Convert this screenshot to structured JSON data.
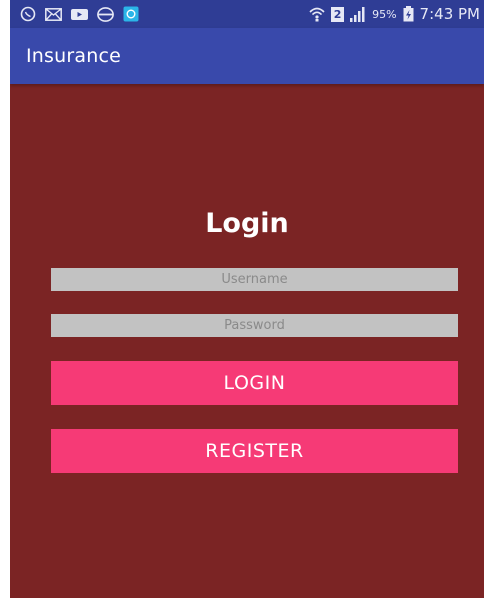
{
  "status_bar": {
    "left_icons": [
      "whatsapp-icon",
      "mail-icon",
      "video-icon",
      "browser-icon",
      "app-notification-icon"
    ],
    "network_badge": "2",
    "battery": "95%",
    "time": "7:43 PM"
  },
  "app_bar": {
    "title": "Insurance"
  },
  "login": {
    "heading": "Login",
    "username_placeholder": "Username",
    "password_placeholder": "Password",
    "login_label": "LOGIN",
    "register_label": "REGISTER"
  },
  "colors": {
    "status_bar": "#2f3d95",
    "app_bar": "#3949ab",
    "background": "#7b2424",
    "field": "#c2c2c2",
    "button": "#f63a76"
  }
}
